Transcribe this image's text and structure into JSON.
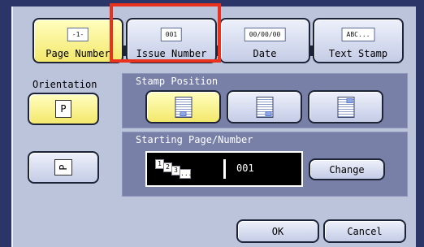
{
  "tabs": [
    {
      "icon": "-1-",
      "label": "Page Number",
      "selected": true
    },
    {
      "icon": "001",
      "label": "Issue Number",
      "selected": false
    },
    {
      "icon": "00/00/00",
      "label": "Date",
      "selected": false
    },
    {
      "icon": "ABC...",
      "label": "Text Stamp",
      "selected": false
    }
  ],
  "orientation": {
    "label": "Orientation",
    "portrait_glyph": "P",
    "landscape_glyph": "P"
  },
  "stamp_position": {
    "title": "Stamp Position",
    "selected_index": 0
  },
  "starting": {
    "title": "Starting Page/Number",
    "sequence": [
      "1",
      "2",
      "3",
      "..."
    ],
    "value": "001",
    "change_label": "Change"
  },
  "footer": {
    "ok_label": "OK",
    "cancel_label": "Cancel"
  },
  "colors": {
    "highlight": "#e8321e",
    "selected": "#f4e86c",
    "panel": "#7880a8",
    "background": "#bcc4dc"
  }
}
